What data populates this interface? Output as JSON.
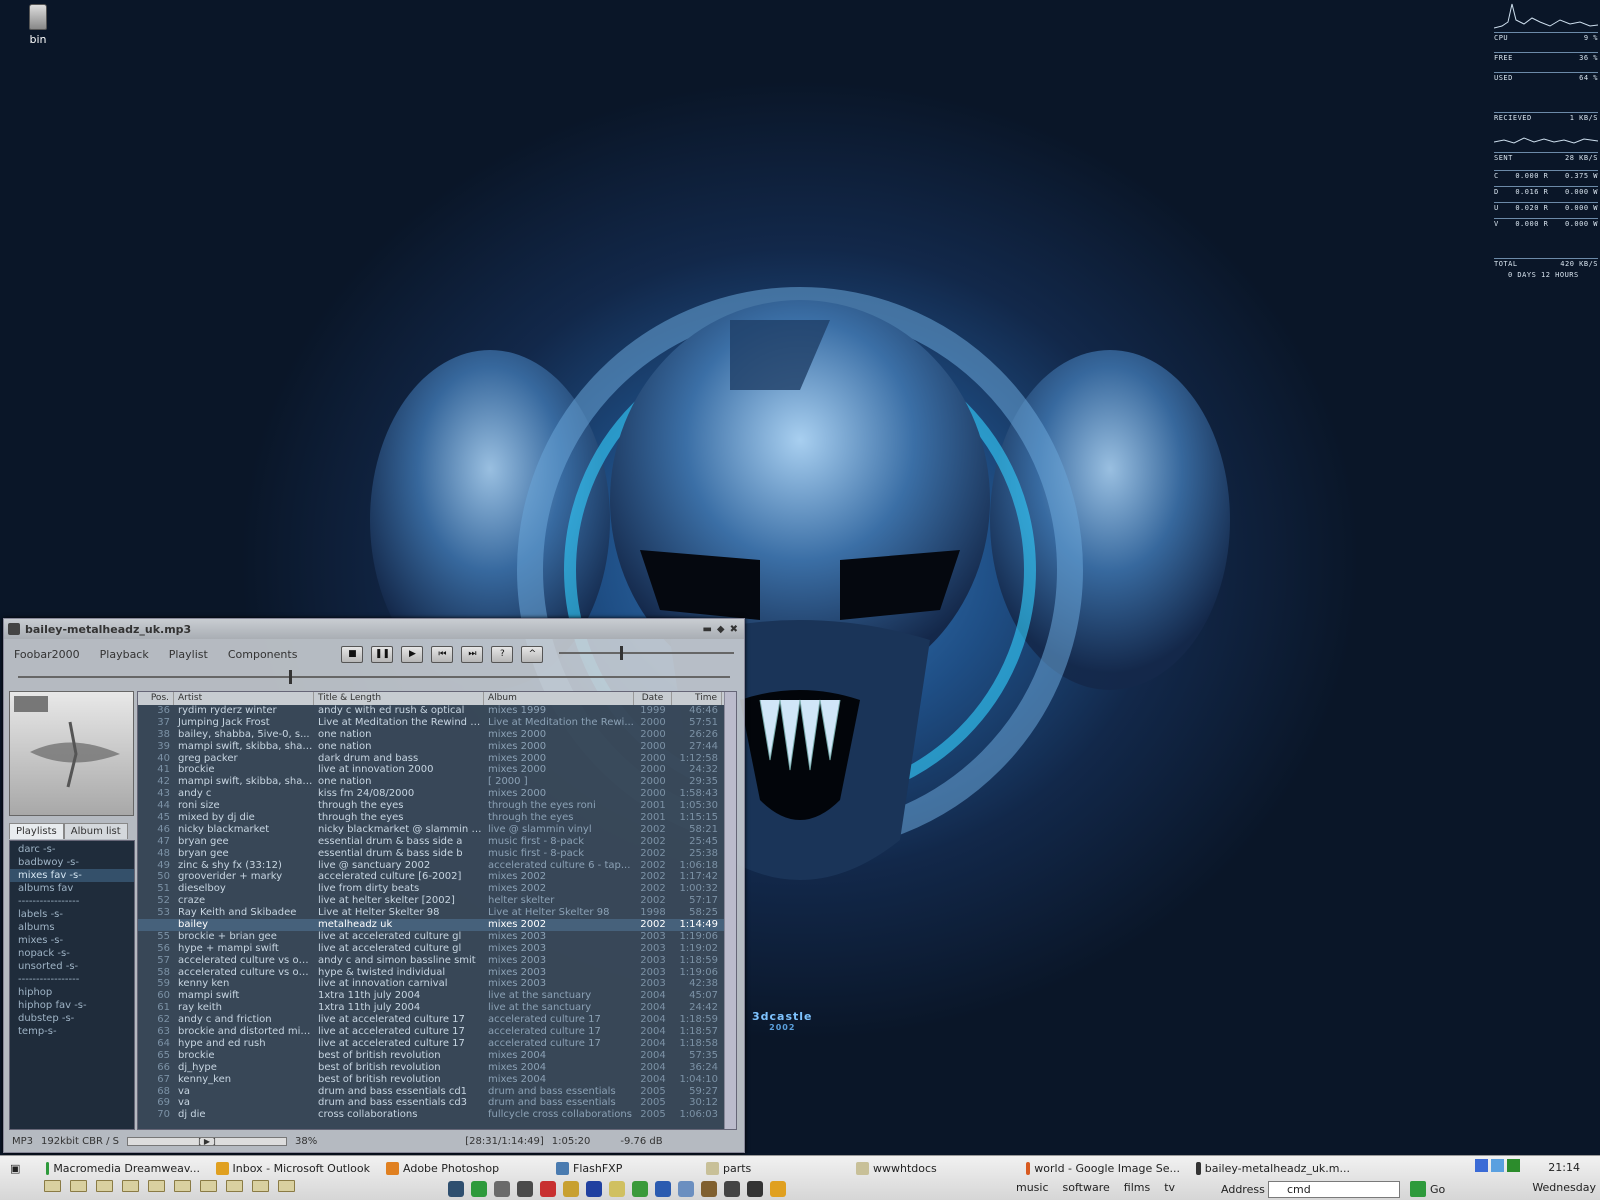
{
  "desktop": {
    "icon_label": "bin",
    "wallpaper_text": "3dcastle",
    "wallpaper_year": "2002"
  },
  "monitor": {
    "rows": [
      {
        "label": "CPU",
        "value": "9 %"
      },
      {
        "label": "FREE",
        "value": "36 %"
      },
      {
        "label": "USED",
        "value": "64 %"
      },
      {
        "label": "RECIEVED",
        "value": "1 KB/S"
      },
      {
        "label": "SENT",
        "value": "28 KB/S"
      }
    ],
    "drives": [
      {
        "letter": "C",
        "r": "0.000",
        "w": "0.375"
      },
      {
        "letter": "D",
        "r": "0.016",
        "w": "0.000"
      },
      {
        "letter": "U",
        "r": "0.020",
        "w": "0.000"
      },
      {
        "letter": "V",
        "r": "0.000",
        "w": "0.000"
      }
    ],
    "r_suffix": "R",
    "w_suffix": "W",
    "total_label": "TOTAL",
    "total_value": "420 KB/S",
    "uptime": "0 DAYS 12 HOURS"
  },
  "player": {
    "title": "bailey-metalheadz_uk.mp3",
    "menu": [
      "Foobar2000",
      "Playback",
      "Playlist",
      "Components"
    ],
    "transport": {
      "stop": "■",
      "pause": "❚❚",
      "play": "▶",
      "prev": "⏮",
      "next": "⏭",
      "random": "?",
      "eject": "^"
    },
    "seek_fraction": 0.38,
    "volume_fraction": 0.35,
    "playlist_tabs": [
      "Playlists",
      "Album list"
    ],
    "playlists": [
      "darc -s-",
      "badbwoy -s-",
      "mixes fav -s-",
      "albums fav",
      "-----------------",
      "labels -s-",
      "albums",
      "mixes -s-",
      "nopack -s-",
      "unsorted -s-",
      "-----------------",
      "hiphop",
      "hiphop fav -s-",
      "dubstep -s-",
      "temp-s-"
    ],
    "selected_playlist": "mixes fav -s-",
    "columns": {
      "pos": "Pos.",
      "artist": "Artist",
      "title": "Title & Length",
      "album": "Album",
      "date": "Date",
      "time": "Time"
    },
    "tracks": [
      [
        "36",
        "rydim ryderz winter",
        "andy c with ed rush & optical",
        "mixes 1999",
        "1999",
        "46:46"
      ],
      [
        "37",
        "Jumping Jack Frost",
        "Live at Meditation the Rewind 1...",
        "Live at Meditation the Rewi...",
        "2000",
        "57:51"
      ],
      [
        "38",
        "bailey, shabba, 5ive-0, s...",
        "one nation",
        "mixes 2000",
        "2000",
        "26:26"
      ],
      [
        "39",
        "mampi swift, skibba, shab...",
        "one nation",
        "mixes 2000",
        "2000",
        "27:44"
      ],
      [
        "40",
        "greg packer",
        "dark drum and bass",
        "mixes 2000",
        "2000",
        "1:12:58"
      ],
      [
        "41",
        "brockie",
        "live at innovation 2000",
        "mixes 2000",
        "2000",
        "24:32"
      ],
      [
        "42",
        "mampi swift, skibba, shab...",
        "one nation",
        "[ 2000 ]",
        "2000",
        "29:35"
      ],
      [
        "43",
        "andy c",
        "kiss fm 24/08/2000",
        "mixes 2000",
        "2000",
        "1:58:43"
      ],
      [
        "44",
        "roni size",
        "through the eyes",
        "through the eyes roni",
        "2001",
        "1:05:30"
      ],
      [
        "45",
        "mixed by dj die",
        "through the eyes",
        "through the eyes",
        "2001",
        "1:15:15"
      ],
      [
        "46",
        "nicky blackmarket",
        "nicky blackmarket @ slammin v...",
        "live @ slammin vinyl",
        "2002",
        "58:21"
      ],
      [
        "47",
        "bryan gee",
        "essential drum & bass side a",
        "music first - 8-pack",
        "2002",
        "25:45"
      ],
      [
        "48",
        "bryan gee",
        "essential drum & bass side b",
        "music first - 8-pack",
        "2002",
        "25:38"
      ],
      [
        "49",
        "zinc & shy fx (33:12)",
        "live @ sanctuary 2002",
        "accelerated culture 6 - tap...",
        "2002",
        "1:06:18"
      ],
      [
        "50",
        "grooverider + marky",
        "accelerated culture [6-2002]",
        "mixes 2002",
        "2002",
        "1:17:42"
      ],
      [
        "51",
        "dieselboy",
        "live from dirty beats",
        "mixes 2002",
        "2002",
        "1:00:32"
      ],
      [
        "52",
        "craze",
        "live at helter skelter [2002]",
        "helter skelter",
        "2002",
        "57:17"
      ],
      [
        "53",
        "Ray Keith and Skibadee",
        "Live at Helter Skelter 98",
        "Live at Helter Skelter 98",
        "1998",
        "58:25"
      ],
      [
        "",
        "bailey",
        "metalheadz uk",
        "mixes 2002",
        "2002",
        "1:14:49"
      ],
      [
        "55",
        "brockie + brian gee",
        "live at accelerated culture gl",
        "mixes 2003",
        "2003",
        "1:19:06"
      ],
      [
        "56",
        "hype + mampi swift",
        "live at accelerated culture gl",
        "mixes 2003",
        "2003",
        "1:19:02"
      ],
      [
        "57",
        "accelerated culture vs on...",
        "andy c and simon bassline smit",
        "mixes 2003",
        "2003",
        "1:18:59"
      ],
      [
        "58",
        "accelerated culture vs on...",
        "hype & twisted individual",
        "mixes 2003",
        "2003",
        "1:19:06"
      ],
      [
        "59",
        "kenny ken",
        "live at innovation carnival",
        "mixes 2003",
        "2003",
        "42:38"
      ],
      [
        "60",
        "mampi swift",
        "1xtra 11th july 2004",
        "live at the sanctuary",
        "2004",
        "45:07"
      ],
      [
        "61",
        "ray keith",
        "1xtra 11th july 2004",
        "live at the sanctuary",
        "2004",
        "24:42"
      ],
      [
        "62",
        "andy c and friction",
        "live at accelerated culture 17",
        "accelerated culture 17",
        "2004",
        "1:18:59"
      ],
      [
        "63",
        "brockie and distorted min...",
        "live at accelerated culture 17",
        "accelerated culture 17",
        "2004",
        "1:18:57"
      ],
      [
        "64",
        "hype and ed rush",
        "live at accelerated culture 17",
        "accelerated culture 17",
        "2004",
        "1:18:58"
      ],
      [
        "65",
        "brockie",
        "best of british revolution",
        "mixes 2004",
        "2004",
        "57:35"
      ],
      [
        "66",
        "dj_hype",
        "best of british revolution",
        "mixes 2004",
        "2004",
        "36:24"
      ],
      [
        "67",
        "kenny_ken",
        "best of british revolution",
        "mixes 2004",
        "2004",
        "1:04:10"
      ],
      [
        "68",
        "va",
        "drum and bass essentials cd1",
        "drum and bass essentials",
        "2005",
        "59:27"
      ],
      [
        "69",
        "va",
        "drum and bass essentials cd3",
        "drum and bass essentials",
        "2005",
        "30:12"
      ],
      [
        "70",
        "dj die",
        "cross collaborations",
        "fullcycle cross collaborations",
        "2005",
        "1:06:03"
      ]
    ],
    "current_index": 18,
    "status": {
      "format": "MP3",
      "bitrate": "192kbit CBR / S",
      "progress_text": "38%",
      "position": "[28:31/1:14:49]",
      "total_time": "1:05:20",
      "gain": "-9.76 dB"
    }
  },
  "taskbar": {
    "tasks": [
      {
        "label": "Macromedia Dreamweav...",
        "color": "#2e9a3c"
      },
      {
        "label": "Inbox - Microsoft Outlook",
        "color": "#e0a020"
      },
      {
        "label": "Adobe Photoshop",
        "color": "#e08020"
      },
      {
        "label": "FlashFXP",
        "color": "#4a7bb0"
      },
      {
        "label": "parts",
        "color": "#c8c098"
      },
      {
        "label": "wwwhtdocs",
        "color": "#c8c098"
      },
      {
        "label": "world - Google Image Se...",
        "color": "#d85a20"
      },
      {
        "label": "bailey-metalheadz_uk.m...",
        "color": "#333333"
      }
    ],
    "links": [
      "music",
      "software",
      "films",
      "tv"
    ],
    "address_label": "Address",
    "address_value": "cmd",
    "go_label": "Go",
    "time": "21:14",
    "day": "Wednesday"
  }
}
